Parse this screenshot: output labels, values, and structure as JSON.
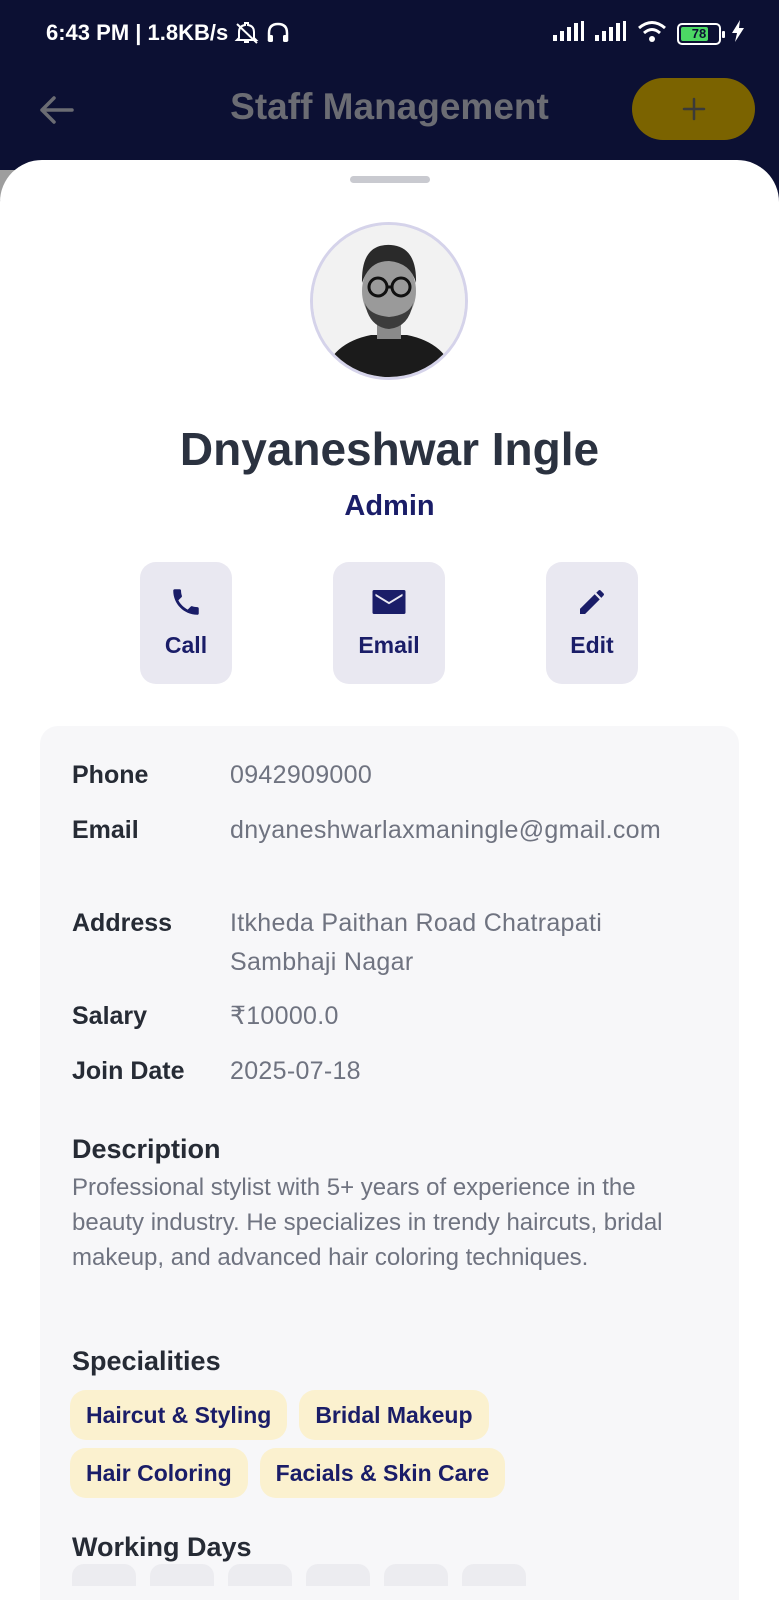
{
  "status_bar": {
    "time_speed": "6:43 PM | 1.8KB/s",
    "battery_level": "78",
    "icons": [
      "mute-icon",
      "headphones-icon",
      "signal-icon",
      "signal-icon",
      "wifi-icon",
      "battery-icon",
      "charging-icon"
    ]
  },
  "header": {
    "title": "Staff Management",
    "add_label": "+"
  },
  "profile": {
    "name": "Dnyaneshwar Ingle",
    "role": "Admin"
  },
  "actions": {
    "call": "Call",
    "email": "Email",
    "edit": "Edit"
  },
  "details": {
    "phone_label": "Phone",
    "phone": "0942909000",
    "email_label": "Email",
    "email": "dnyaneshwarlaxmaningle@gmail.com",
    "address_label": "Address",
    "address": "Itkheda Paithan Road Chatrapati Sambhaji Nagar",
    "salary_label": "Salary",
    "salary": "₹10000.0",
    "join_label": "Join Date",
    "join_date": "2025-07-18"
  },
  "description": {
    "title": "Description",
    "text": "Professional stylist with 5+ years of experience in the beauty industry. He specializes in trendy haircuts, bridal makeup, and advanced hair coloring techniques."
  },
  "specialities": {
    "title": "Specialities",
    "items": [
      "Haircut & Styling",
      "Bridal Makeup",
      "Hair Coloring",
      "Facials & Skin Care"
    ]
  },
  "working_days": {
    "title": "Working Days"
  },
  "colors": {
    "header_bg": "#0c1033",
    "accent_navy": "#1a1d68",
    "add_button": "#7b6300",
    "chip_bg": "#fbf1cf"
  }
}
